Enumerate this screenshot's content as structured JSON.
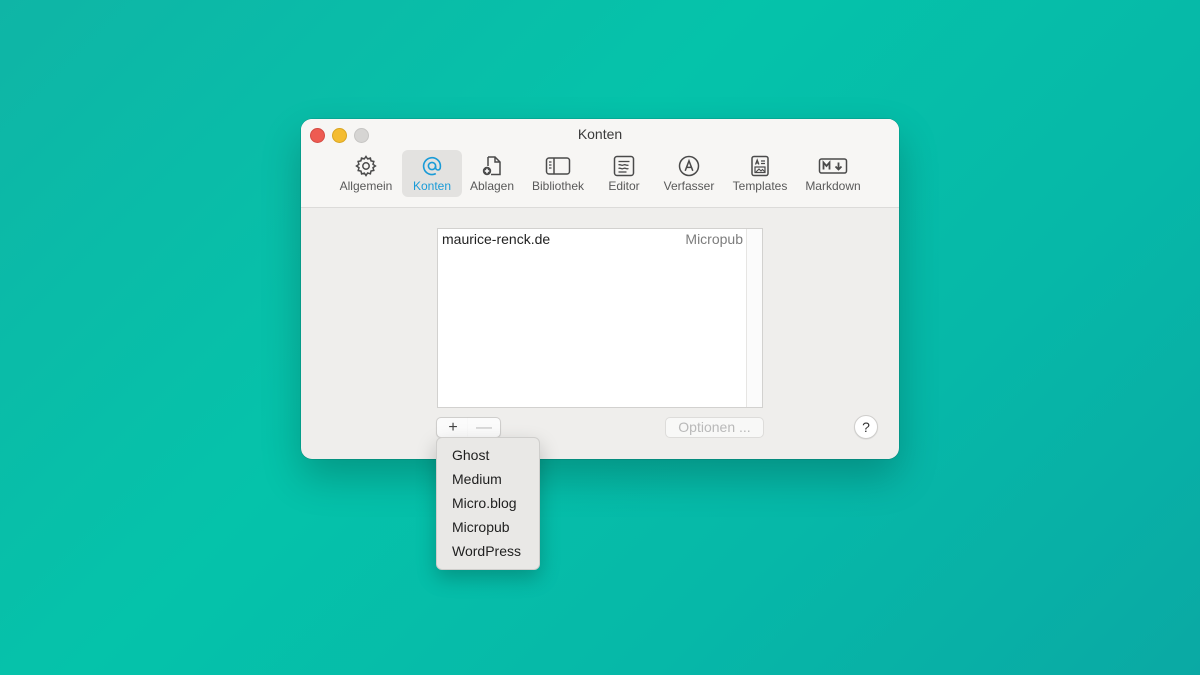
{
  "window": {
    "title": "Konten"
  },
  "toolbar": {
    "items": [
      {
        "label": "Allgemein",
        "icon": "gear-icon"
      },
      {
        "label": "Konten",
        "icon": "at-icon",
        "active": true
      },
      {
        "label": "Ablagen",
        "icon": "document-add-icon"
      },
      {
        "label": "Bibliothek",
        "icon": "sidebar-icon"
      },
      {
        "label": "Editor",
        "icon": "editor-icon"
      },
      {
        "label": "Verfasser",
        "icon": "author-circle-a-icon"
      },
      {
        "label": "Templates",
        "icon": "template-icon"
      },
      {
        "label": "Markdown",
        "icon": "markdown-icon"
      }
    ],
    "accent_color": "#1a9bd7"
  },
  "accounts": {
    "rows": [
      {
        "name": "maurice-renck.de",
        "type": "Micropub"
      }
    ]
  },
  "controls": {
    "add": "+",
    "remove": "—",
    "options": "Optionen ...",
    "help": "?"
  },
  "menu": {
    "items": [
      "Ghost",
      "Medium",
      "Micro.blog",
      "Micropub",
      "WordPress"
    ]
  }
}
